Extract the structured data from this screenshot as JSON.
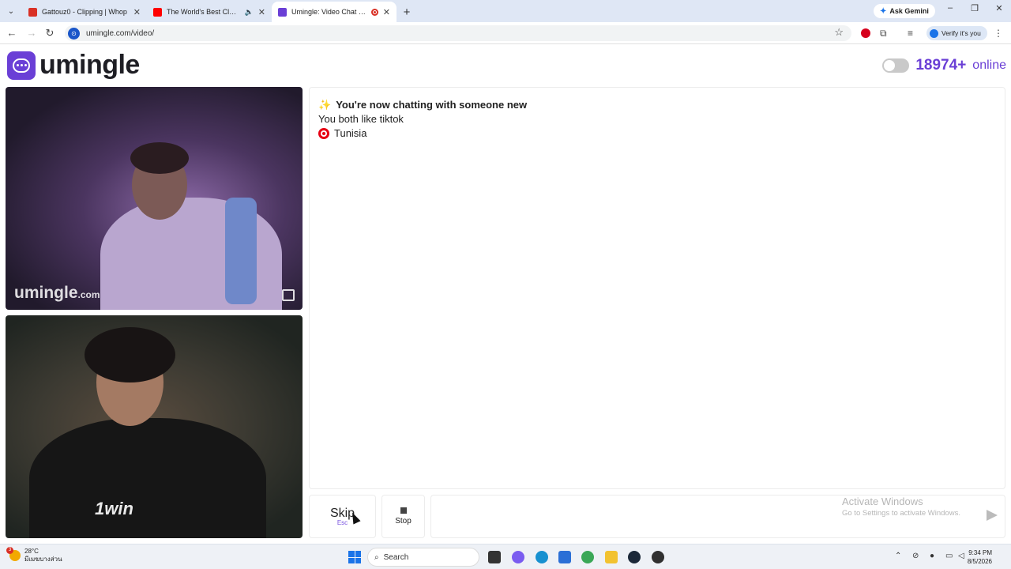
{
  "browser": {
    "tabs": [
      {
        "title": "Gattouz0 - Clipping | Whop",
        "favicon_color": "#d93025",
        "active": false
      },
      {
        "title": "The World's Best Classical Music",
        "favicon_color": "#ff0000",
        "active": false
      },
      {
        "title": "Umingle: Video Chat with Strangers",
        "favicon_color": "#6a3fd6",
        "active": true
      }
    ],
    "ask_gemini_label": "Ask Gemini",
    "url": "umingle.com/video/",
    "verify_label": "Verify it's you"
  },
  "site": {
    "logo_text": "umingle",
    "online_count": "18974+",
    "online_label": "online"
  },
  "videos": {
    "stranger_watermark": "umingle",
    "stranger_watermark_suffix": ".com",
    "self_shirt_text": "1win"
  },
  "chat": {
    "messages": [
      {
        "icon": "sparkle-icon",
        "text": "You're now chatting with someone new",
        "bold": true
      },
      {
        "icon": null,
        "text": "You both like tiktok",
        "bold": false
      },
      {
        "icon": "tunisia-flag-icon",
        "text": "Tunisia",
        "bold": false
      }
    ],
    "skip_label": "Skip",
    "skip_key": "Esc",
    "stop_label": "Stop",
    "input_value": "",
    "accent_color": "#6a3fd6"
  },
  "overlay": {
    "activate_title": "Activate Windows",
    "activate_sub": "Go to Settings to activate Windows."
  },
  "taskbar": {
    "weather_badge": "3",
    "temperature": "28°C",
    "weather_desc": "มีเมฆบางส่วน",
    "search_placeholder": "Search",
    "time": "9:34 PM",
    "date": "8/5/2026"
  }
}
